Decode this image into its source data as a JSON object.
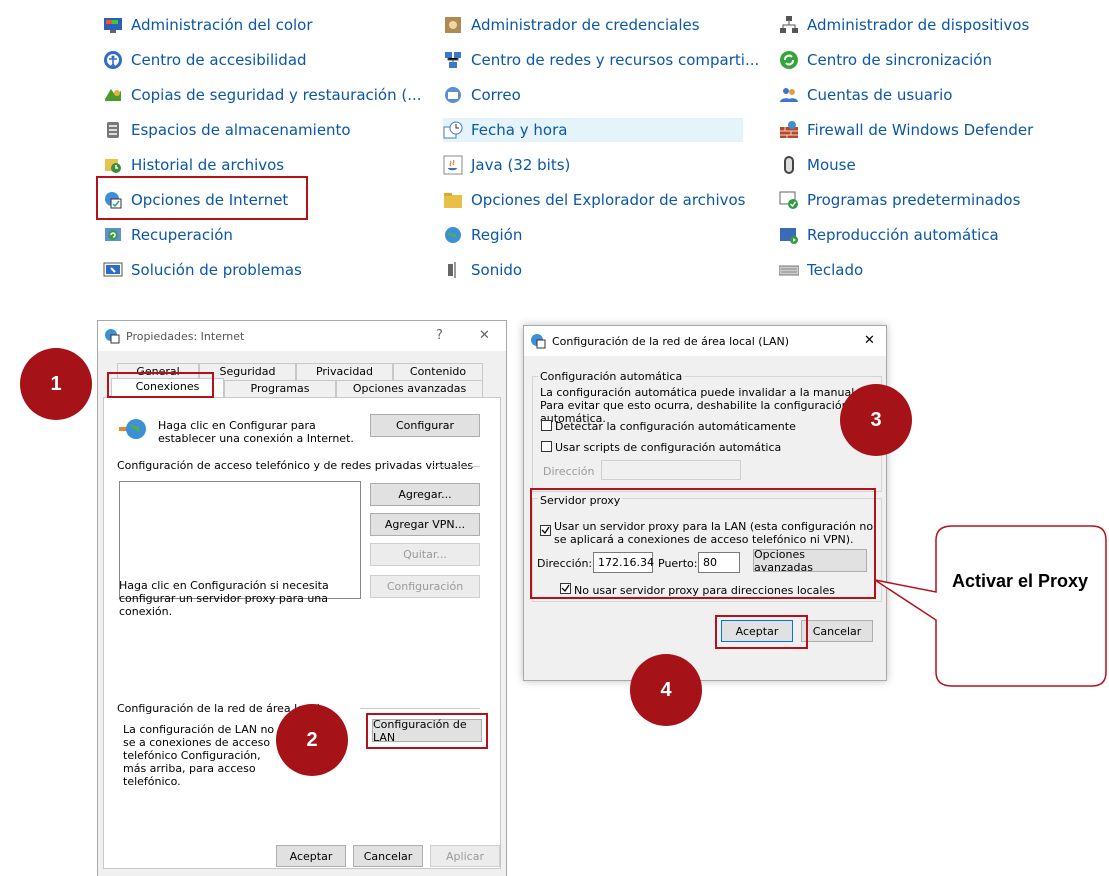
{
  "control_panel": {
    "col1": [
      "Administración del color",
      "Centro de accesibilidad",
      "Copias de seguridad y restauración (...",
      "Espacios de almacenamiento",
      "Historial de archivos",
      "Opciones de Internet",
      "Recuperación",
      "Solución de problemas"
    ],
    "col2": [
      "Administrador de credenciales",
      "Centro de redes y recursos comparti...",
      "Correo",
      "Fecha y hora",
      "Java (32 bits)",
      "Opciones del Explorador de archivos",
      "Región",
      "Sonido"
    ],
    "col3": [
      "Administrador de dispositivos",
      "Centro de sincronización",
      "Cuentas de usuario",
      "Firewall de Windows Defender",
      "Mouse",
      "Programas predeterminados",
      "Reproducción automática",
      "Teclado"
    ]
  },
  "internet_props": {
    "title": "Propiedades: Internet",
    "help": "?",
    "close": "✕",
    "tabs_row1": [
      "General",
      "Seguridad",
      "Privacidad",
      "Contenido"
    ],
    "tabs_row2": [
      "Conexiones",
      "Programas",
      "Opciones avanzadas"
    ],
    "setup_text": "Haga clic en Configurar para establecer una conexión a Internet.",
    "setup_button": "Configurar",
    "dialup_header": "Configuración de acceso telefónico y de redes privadas virtuales",
    "add_button": "Agregar...",
    "add_vpn_button": "Agregar VPN...",
    "remove_button": "Quitar...",
    "settings_button": "Configuración",
    "proxy_hint": "Haga clic en Configuración si necesita configurar un servidor proxy para una conexión.",
    "lan_header": "Configuración de la red de área local",
    "lan_text": "La configuración de LAN no se a conexiones de acceso telefónico Configuración, más arriba, para acceso telefónico.",
    "lan_button": "Configuración de LAN",
    "ok": "Aceptar",
    "cancel": "Cancelar",
    "apply": "Aplicar"
  },
  "lan_dialog": {
    "title": "Configuración de la red de área local (LAN)",
    "close": "✕",
    "auto_header": "Configuración automática",
    "auto_text": "La configuración automática puede invalidar a la manual. Para evitar que esto ocurra, deshabilite la configuración automática.",
    "detect_label": "Detectar la configuración automáticamente",
    "scripts_label": "Usar scripts de configuración automática",
    "address_label": "Dirección",
    "proxy_header": "Servidor proxy",
    "use_proxy_label": "Usar un servidor proxy para la LAN (esta configuración no se aplicará a conexiones de acceso telefónico ni VPN).",
    "proxy_address_label": "Dirección:",
    "proxy_address_value": "172.16.34",
    "port_label": "Puerto:",
    "port_value": "80",
    "advanced_button": "Opciones avanzadas",
    "bypass_label": "No usar servidor proxy para direcciones locales",
    "ok": "Aceptar",
    "cancel": "Cancelar"
  },
  "annotations": {
    "step1": "1",
    "step2": "2",
    "step3": "3",
    "step4": "4",
    "callout": "Activar el Proxy"
  },
  "colors": {
    "accent_red": "#a51218",
    "link_blue": "#0b57a6"
  }
}
